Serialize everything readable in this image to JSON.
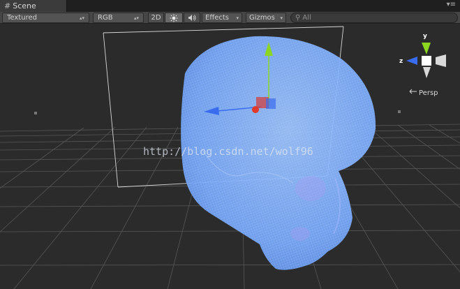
{
  "tab": {
    "icon": "grid-icon",
    "label": "Scene",
    "menu_glyph": "▾≡"
  },
  "toolbar": {
    "draw_mode": "Textured",
    "render_mode": "RGB",
    "mode_2d": "2D",
    "effects": "Effects",
    "gizmos": "Gizmos",
    "search_placeholder": "All"
  },
  "gizmo": {
    "y": "y",
    "z": "z",
    "projection": "Persp"
  },
  "watermark": "http://blog.csdn.net/wolf96",
  "colors": {
    "viewport_bg": "#2b2b2b",
    "mesh_blue": "#7fb2ff",
    "axis_y": "#8cd622",
    "axis_z": "#3a6cf0",
    "axis_x": "#e03a2c",
    "grid_line": "#565656"
  }
}
